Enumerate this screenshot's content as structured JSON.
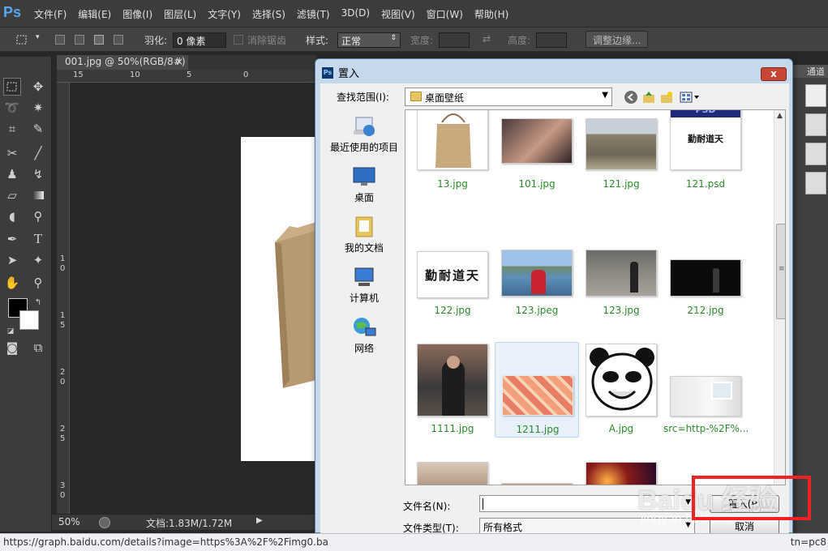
{
  "app": {
    "logo": "Ps"
  },
  "menu": [
    "文件(F)",
    "编辑(E)",
    "图像(I)",
    "图层(L)",
    "文字(Y)",
    "选择(S)",
    "滤镜(T)",
    "3D(D)",
    "视图(V)",
    "窗口(W)",
    "帮助(H)"
  ],
  "options": {
    "feather_label": "羽化:",
    "feather_value": "0 像素",
    "antialias_label": "消除锯齿",
    "style_label": "样式:",
    "style_value": "正常",
    "width_label": "宽度:",
    "height_label": "高度:",
    "refine_edge": "调整边缘..."
  },
  "document": {
    "tab": "001.jpg @ 50%(RGB/8#)",
    "tab_close": "×",
    "ruler_h": [
      "15",
      "10",
      "5",
      "0"
    ],
    "ruler_v": [
      "1",
      "0",
      "1",
      "5",
      "2",
      "0",
      "2",
      "5",
      "3",
      "0"
    ],
    "zoom": "50%",
    "doc_info": "文档:1.83M/1.72M"
  },
  "right_panel": {
    "tab": "通道"
  },
  "dialog": {
    "title": "置入",
    "close": "x",
    "look_in_label": "查找范围(I):",
    "look_in_value": "桌面壁纸",
    "places": [
      {
        "label": "最近使用的项目",
        "icon": "recent-items-icon"
      },
      {
        "label": "桌面",
        "icon": "desktop-icon"
      },
      {
        "label": "我的文档",
        "icon": "documents-icon"
      },
      {
        "label": "计算机",
        "icon": "computer-icon"
      },
      {
        "label": "网络",
        "icon": "network-icon"
      }
    ],
    "files": [
      {
        "name": "13.jpg"
      },
      {
        "name": "101.jpg"
      },
      {
        "name": "121.jpg"
      },
      {
        "name": "121.psd"
      },
      {
        "name": "122.jpg"
      },
      {
        "name": "123.jpeg"
      },
      {
        "name": "123.jpg"
      },
      {
        "name": "212.jpg"
      },
      {
        "name": "1111.jpg"
      },
      {
        "name": "1211.jpg"
      },
      {
        "name": "A.jpg"
      },
      {
        "name": "src=http-%2F%..."
      }
    ],
    "thumb_text": {
      "psd_header": "PSD",
      "calligraphy": "勤耐道天"
    },
    "filename_label": "文件名(N):",
    "filename_value": "",
    "filetype_label": "文件类型(T):",
    "filetype_value": "所有格式",
    "place_button": "置入(P)",
    "cancel_button": "取消"
  },
  "statusbar": {
    "url": "https://graph.baidu.com/details?image=https%3A%2F%2Fimg0.ba",
    "url_tail": "tn=pc8"
  },
  "watermark": {
    "main": "Baidu 经验",
    "sub": "jingyan.baidu.com"
  }
}
